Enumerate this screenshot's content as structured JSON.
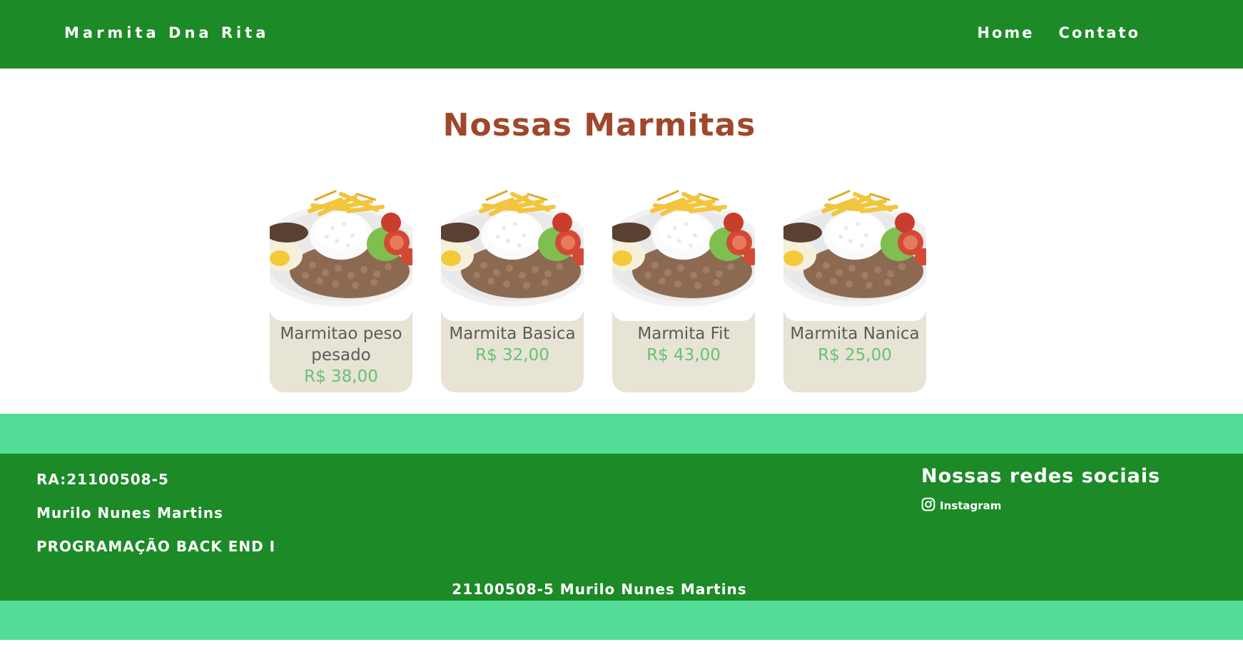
{
  "nav": {
    "brand": "Marmita Dna Rita",
    "links": [
      "Home",
      "Contato"
    ]
  },
  "main": {
    "title": "Nossas Marmitas",
    "products": [
      {
        "name": "Marmitao peso pesado",
        "price": "R$ 38,00",
        "image_icon": "marmita-dish-image"
      },
      {
        "name": "Marmita Basica",
        "price": "R$ 32,00",
        "image_icon": "marmita-dish-image"
      },
      {
        "name": "Marmita Fit",
        "price": "R$ 43,00",
        "image_icon": "marmita-dish-image"
      },
      {
        "name": "Marmita Nanica",
        "price": "R$ 25,00",
        "image_icon": "marmita-dish-image"
      }
    ]
  },
  "footer": {
    "ra": "RA:21100508-5",
    "name": "Murilo Nunes Martins",
    "course": "PROGRAMAÇÃO BACK END I",
    "social_title": "Nossas redes sociais",
    "social_link": "Instagram",
    "social_icon": "instagram-icon",
    "copyright": "21100508-5 Murilo Nunes Martins"
  },
  "colors": {
    "navbar": "#1b8a27",
    "footer": "#1b8a27",
    "band": "#52dc96",
    "title": "#a0472b",
    "card_bg": "#e7e3d5",
    "price": "#66c276"
  }
}
